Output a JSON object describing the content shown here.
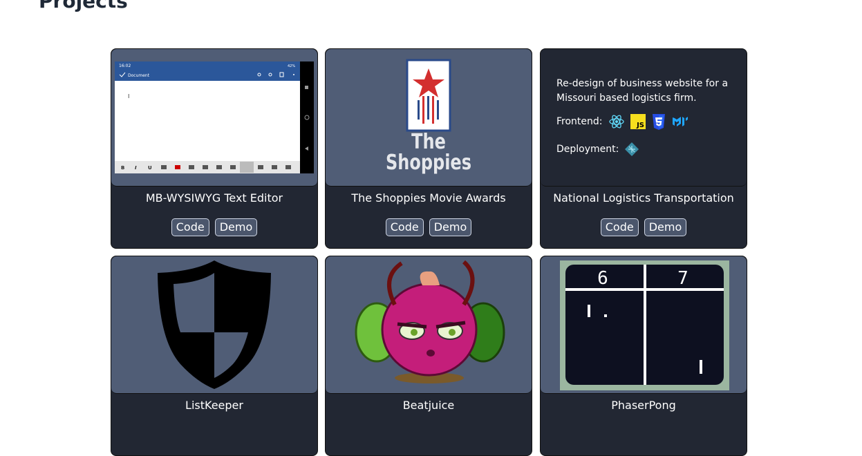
{
  "section": {
    "title": "Projects"
  },
  "projects": [
    {
      "title": "MB-WYSIWYG Text Editor",
      "code": "Code",
      "demo": "Demo",
      "preview": {
        "status_time": "16:02",
        "status_battery": "42%",
        "doc_label": "Document",
        "cursor": "I"
      }
    },
    {
      "title": "The Shoppies Movie Awards",
      "code": "Code",
      "demo": "Demo",
      "logo": {
        "line1": "The",
        "line2": "Shoppies"
      }
    },
    {
      "title": "National Logistics Transportation",
      "code": "Code",
      "demo": "Demo",
      "description": "Re-design of business website for a Missouri based logistics firm.",
      "frontend_label": "Frontend:",
      "deployment_label": "Deployment:",
      "js_badge": "JS"
    },
    {
      "title": "ListKeeper"
    },
    {
      "title": "Beatjuice"
    },
    {
      "title": "PhaserPong",
      "score_left": "6",
      "score_right": "7"
    }
  ]
}
